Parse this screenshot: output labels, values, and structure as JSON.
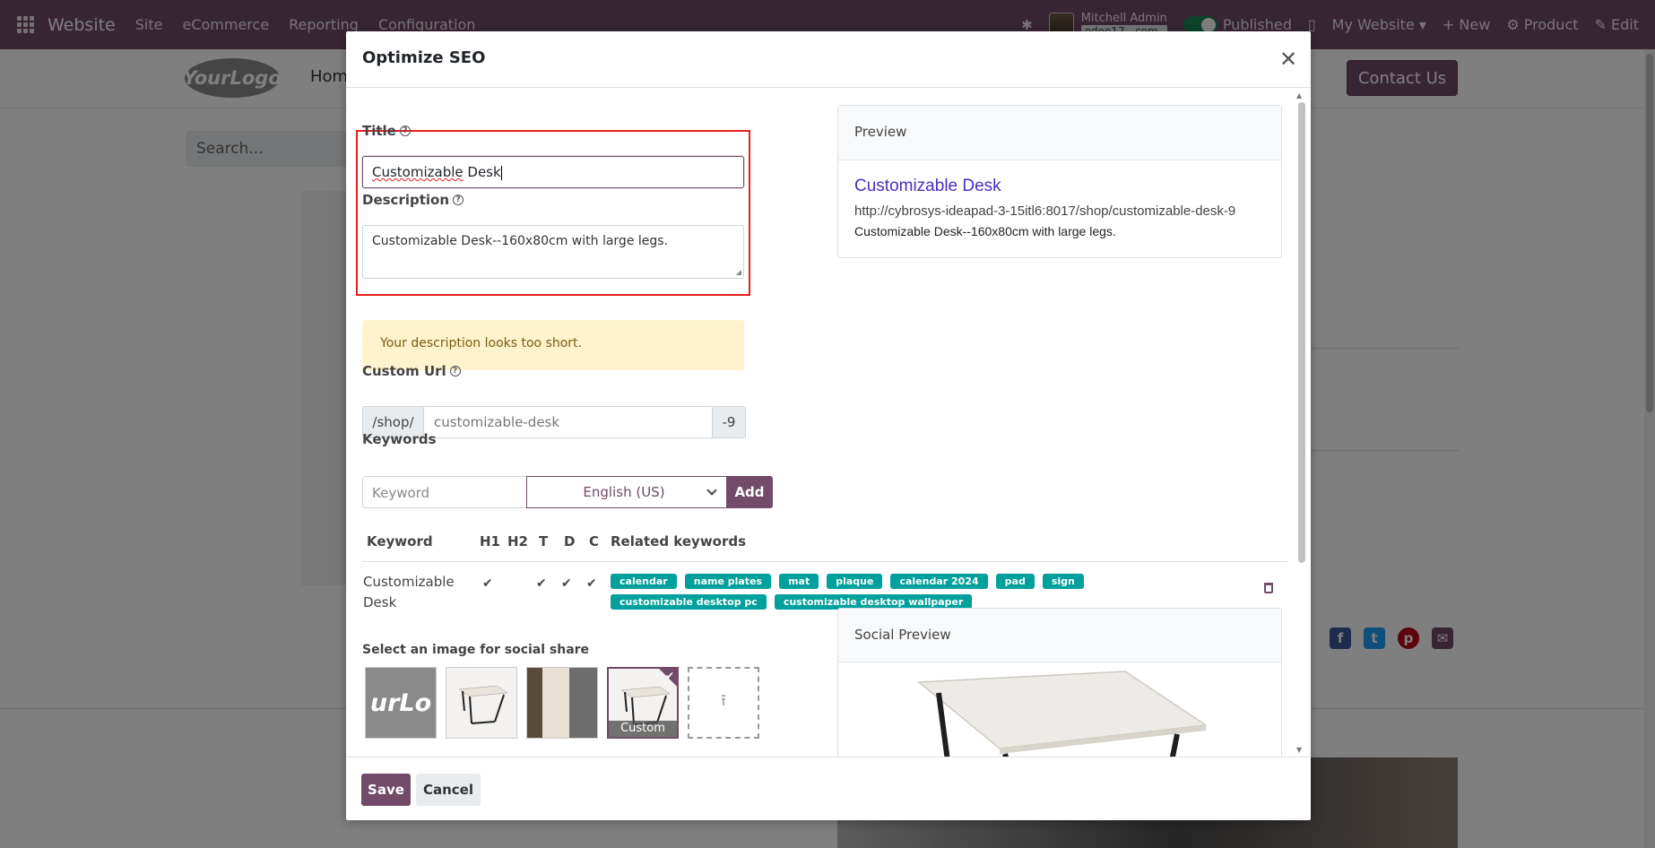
{
  "navbar": {
    "app_name": "Website",
    "menus": [
      "Site",
      "eCommerce",
      "Reporting",
      "Configuration"
    ],
    "user_name": "Mitchell Admin",
    "db_name": "odoo17...com",
    "published_label": "Published",
    "my_website_label": "My Website",
    "new_label": "New",
    "product_label": "Product",
    "edit_label": "Edit"
  },
  "website": {
    "logo_text": "YourLogo",
    "home_label": "Home",
    "contact_label": "Contact Us",
    "search_placeholder": "Search..."
  },
  "modal": {
    "title": "Optimize SEO",
    "close_glyph": "✕",
    "title_label": "Title",
    "title_value_spell": "Customizable",
    "title_value_rest": " Desk",
    "description_label": "Description",
    "description_value": "Customizable Desk--160x80cm with large legs.",
    "warning_text": "Your description looks too short.",
    "custom_url_label": "Custom Url",
    "url_prefix": "/shop/",
    "url_value": "customizable-desk",
    "url_suffix": "-9",
    "keywords_label": "Keywords",
    "keyword_placeholder": "Keyword",
    "language": "English (US)",
    "add_label": "Add",
    "table_headers": {
      "keyword": "Keyword",
      "h1": "H1",
      "h2": "H2",
      "t": "T",
      "d": "D",
      "c": "C",
      "related": "Related keywords"
    },
    "keyword_row": {
      "keyword": "Customizable Desk",
      "check_glyph": "✔",
      "related": [
        "calendar",
        "name plates",
        "mat",
        "plaque",
        "calendar 2024",
        "pad",
        "sign",
        "customizable desktop pc",
        "customizable desktop wallpaper"
      ]
    },
    "social_image_label": "Select an image for social share",
    "logo_tile_text": "urLo",
    "custom_caption": "Custom",
    "upload_glyph": "⭱",
    "preview_label": "Preview",
    "preview_title": "Customizable Desk",
    "preview_url": "http://cybrosys-ideapad-3-15itl6:8017/shop/customizable-desk-9",
    "preview_description": "Customizable Desk--160x80cm with large legs.",
    "social_preview_label": "Social Preview",
    "save_label": "Save",
    "cancel_label": "Cancel"
  },
  "colors": {
    "brand": "#714b67",
    "tag": "#00a09d",
    "warning_bg": "#fff3cd",
    "highlight": "#e61e1e",
    "preview_link": "#4b2cc0"
  }
}
